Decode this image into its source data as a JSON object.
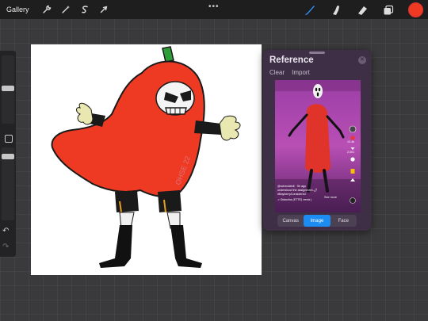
{
  "topbar": {
    "gallery_label": "Gallery",
    "more_label": "•••",
    "active_color": "#ee3a23"
  },
  "reference": {
    "title": "Reference",
    "clear_label": "Clear",
    "import_label": "Import",
    "tabs": [
      {
        "label": "Canvas",
        "active": false
      },
      {
        "label": "Image",
        "active": true
      },
      {
        "label": "Face",
        "active": false
      }
    ],
    "video": {
      "caption_lines": [
        "@scheduledt · 5h ago",
        "understood the assignment 🌶",
        "#BayberryConsidered",
        "♫ Disturbia (ETTE) remix |"
      ],
      "see_more": "See more",
      "counts": [
        "13.4k",
        "2,001"
      ]
    }
  },
  "drawing": {
    "signature": "OHSE 22",
    "colors": {
      "body": "#ee3a23",
      "outline": "#1a1a1a",
      "stem": "#2f9e3a",
      "glove": "#e8e8b0",
      "mask": "#f4f4f4"
    }
  }
}
